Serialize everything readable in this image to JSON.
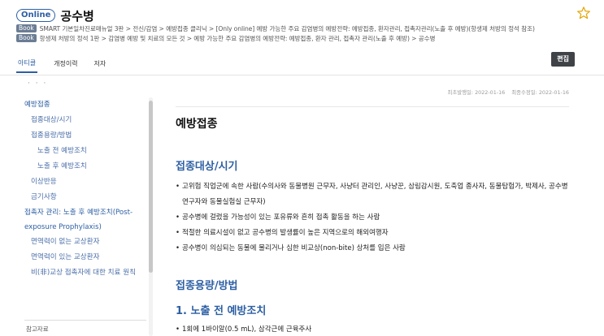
{
  "header": {
    "badge": "Online",
    "title": "공수병",
    "paths": [
      {
        "badge": "Book",
        "text": "SMART 기본일차진료매뉴얼 3판 > 전신/감염 > 예방접종 클리닉 > [Only online] 예방 가능한 주요 감염병의 예방전략: 예방접종, 환자관리, 접촉자관리(노출 후 예방)(항생제 처방의 정석 참조)"
      },
      {
        "badge": "Book",
        "text": "항생제 처방의 정석 1판 > 감염병 예방 및 치료의 모든 것 > 예방 가능한 주요 감염병의 예방전략: 예방접종, 환자 관리, 접촉자 관리(노출 후 예방) > 공수병"
      }
    ],
    "tabs": [
      "아티클",
      "개정이력",
      "저자"
    ],
    "edit_label": "편집"
  },
  "toc": {
    "dots": "· · ·",
    "items": [
      {
        "label": "예방접종",
        "level": 1
      },
      {
        "label": "접종대상/시기",
        "level": 2
      },
      {
        "label": "접종용량/방법",
        "level": 2
      },
      {
        "label": "노출 전 예방조치",
        "level": 3
      },
      {
        "label": "노출 후 예방조치",
        "level": 3
      },
      {
        "label": "이상반응",
        "level": 2
      },
      {
        "label": "금기사항",
        "level": 2
      },
      {
        "label": "접촉자 관리: 노출 후 예방조치(Post-exposure Prophylaxis)",
        "level": 1
      },
      {
        "label": "면역력이 없는 교상환자",
        "level": 2
      },
      {
        "label": "면역력이 있는 교상환자",
        "level": 2
      },
      {
        "label": "비(非)교상 접촉자에 대한 치료 원칙",
        "level": 2
      }
    ],
    "footer": "참고자료"
  },
  "content": {
    "published": "최초발행일: 2022-01-16",
    "modified": "최종수정일: 2022-01-16",
    "heading": "예방접종",
    "section1": {
      "title": "접종대상/시기",
      "bullets": [
        "고위험 직업군에 속한 사람(수의사와 동물병원 근무자, 사냥터 관리인, 사냥꾼, 삼림감시원, 도축업 종사자, 동물탐험가, 박제사, 공수병 연구자와 동물실험실 근무자)",
        "공수병에 걸렸을 가능성이 있는 포유류와 흔히 접촉 활동을 하는 사람",
        "적절한 의료시설이 없고 공수병의 발생률이 높은 지역으로의 해외여행자",
        "공수병이 의심되는 동물에 물리거나 심한 비교상(non-bite) 상처를 입은 사람"
      ]
    },
    "section2": {
      "title": "접종용량/방법",
      "subtitle": "1. 노출 전 예방조치",
      "bullets": [
        "1회에 1바이알(0.5 mL), 삼각근에 근육주사"
      ]
    }
  },
  "colors": {
    "accent": "#2d5fa3",
    "edit_button": "#3f4247",
    "badge": "#6b7d94"
  }
}
